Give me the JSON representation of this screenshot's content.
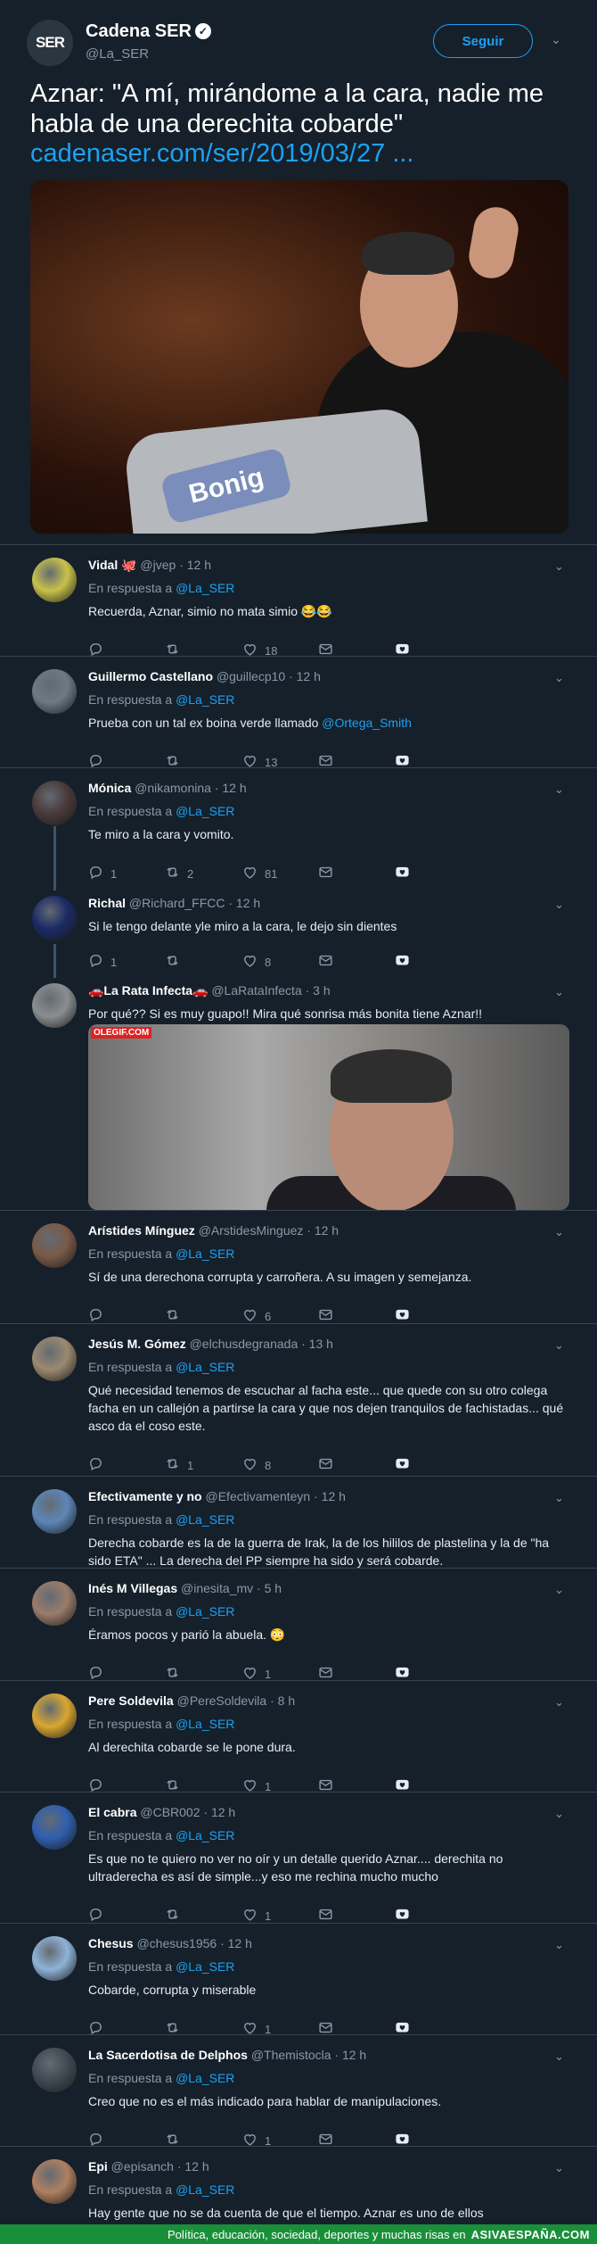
{
  "main_tweet": {
    "name": "Cadena SER",
    "handle": "@La_SER",
    "avatar_text": "SER",
    "follow_label": "Seguir",
    "text": "Aznar: \"A mí, mirándome a la cara, nadie me habla de una derechita cobarde\"",
    "link": "cadenaser.com/ser/2019/03/27 ...",
    "photo_sign": "Bonig"
  },
  "replies": [
    {
      "name": "Vidal 🐙",
      "handle": "@jvep",
      "time": "· 12 h",
      "in_reply": "En respuesta a ",
      "mention": "@La_SER",
      "text": "Recuerda, Aznar, simio no mata simio 😂😂",
      "replies": "",
      "retweets": "",
      "likes": "18"
    },
    {
      "name": "Guillermo Castellano",
      "handle": "@guillecp10",
      "time": "· 12 h",
      "in_reply": "En respuesta a ",
      "mention": "@La_SER",
      "text": "Prueba con un tal ex boina verde llamado ",
      "text_mention": "@Ortega_Smith",
      "replies": "",
      "retweets": "",
      "likes": "13"
    },
    {
      "name": "Mónica",
      "handle": "@nikamonina",
      "time": "· 12 h",
      "in_reply": "En respuesta a ",
      "mention": "@La_SER",
      "text": "Te miro a la cara y vomito.",
      "replies": "1",
      "retweets": "2",
      "likes": "81"
    },
    {
      "name": "Richal",
      "handle": "@Richard_FFCC",
      "time": "· 12 h",
      "text": "Si le tengo delante yle miro a la cara, le dejo sin dientes",
      "replies": "1",
      "retweets": "",
      "likes": "8"
    },
    {
      "name": "🚗La Rata Infecta🚗",
      "handle": "@LaRataInfecta",
      "time": "· 3 h",
      "text": "Por qué?? Si es muy guapo!! Mira qué sonrisa más bonita tiene Aznar!!",
      "gif_logo": "OLEGIF.COM"
    },
    {
      "name": "Arístides Mínguez",
      "handle": "@ArstidesMinguez",
      "time": "· 12 h",
      "in_reply": "En respuesta a ",
      "mention": "@La_SER",
      "text": "Sí de una derechona corrupta y carroñera. A su imagen y semejanza.",
      "replies": "",
      "retweets": "",
      "likes": "6"
    },
    {
      "name": "Jesús M. Gómez",
      "handle": "@elchusdegranada",
      "time": "· 13 h",
      "in_reply": "En respuesta a ",
      "mention": "@La_SER",
      "text": "Qué necesidad tenemos de escuchar al facha este... que quede con su otro colega facha en un callejón a partirse la cara y que nos dejen tranquilos de fachistadas... qué asco da el coso este.",
      "replies": "",
      "retweets": "1",
      "likes": "8"
    },
    {
      "name": "Efectivamente y no",
      "handle": "@Efectivamenteyn",
      "time": "· 12 h",
      "in_reply": "En respuesta a ",
      "mention": "@La_SER",
      "text": "Derecha cobarde es la de la guerra de Irak, la de los hililos de plastelina  y la de \"ha sido ETA\" ... La derecha del PP siempre ha sido y será cobarde."
    },
    {
      "name": "Inés M Villegas",
      "handle": "@inesita_mv",
      "time": "· 5 h",
      "in_reply": "En respuesta a ",
      "mention": "@La_SER",
      "text": "Éramos pocos y parió la abuela. 😳",
      "replies": "",
      "retweets": "",
      "likes": "1"
    },
    {
      "name": "Pere Soldevila",
      "handle": "@PereSoldevila",
      "time": "· 8 h",
      "in_reply": "En respuesta a ",
      "mention": "@La_SER",
      "text": "Al derechita cobarde se le pone dura.",
      "replies": "",
      "retweets": "",
      "likes": "1"
    },
    {
      "name": "El cabra",
      "handle": "@CBR002",
      "time": "· 12 h",
      "in_reply": "En respuesta a ",
      "mention": "@La_SER",
      "text": "Es que no te quiero no ver no oír y un detalle querido Aznar.... derechita no ultraderecha es así de simple...y eso me rechina mucho mucho",
      "replies": "",
      "retweets": "",
      "likes": "1"
    },
    {
      "name": "Chesus",
      "handle": "@chesus1956",
      "time": "· 12 h",
      "in_reply": "En respuesta a ",
      "mention": "@La_SER",
      "text": "Cobarde, corrupta y miserable",
      "replies": "",
      "retweets": "",
      "likes": "1"
    },
    {
      "name": "La Sacerdotisa de Delphos",
      "handle": "@Themistocla",
      "time": "· 12 h",
      "in_reply": "En respuesta a ",
      "mention": "@La_SER",
      "text": "Creo que no es el más indicado para hablar de manipulaciones.",
      "replies": "",
      "retweets": "",
      "likes": "1"
    },
    {
      "name": "Epi",
      "handle": "@episanch",
      "time": "· 12 h",
      "in_reply": "En respuesta a ",
      "mention": "@La_SER",
      "text": "Hay gente que no se da cuenta de que el tiempo. Aznar es uno de ellos"
    }
  ],
  "footer": {
    "tagline": "Política, educación, sociedad, deportes y muchas risas en",
    "brand": "ASIVAESPAÑA.COM"
  },
  "colors": {
    "background": "#15202b",
    "accent": "#1da1f2",
    "muted": "#8899a6",
    "footer": "#1a8f3a"
  },
  "icons": [
    "reply-icon",
    "retweet-icon",
    "like-icon",
    "message-icon",
    "heart-badge-icon",
    "chevron-down-icon",
    "verified-icon"
  ]
}
